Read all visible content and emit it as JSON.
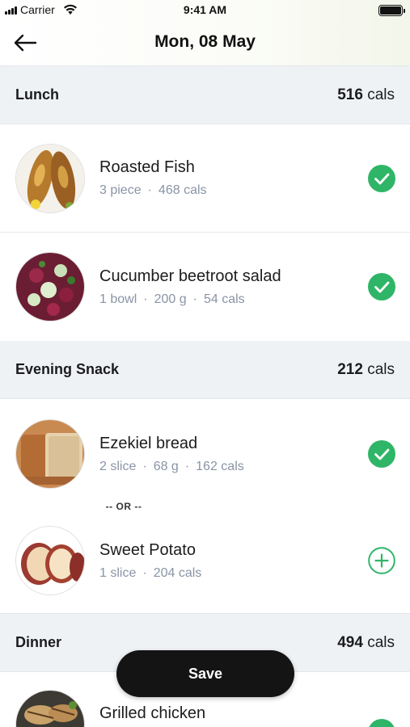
{
  "status_bar": {
    "carrier": "Carrier",
    "time": "9:41 AM"
  },
  "header": {
    "title": "Mon, 08 May"
  },
  "sections": [
    {
      "title": "Lunch",
      "cals_value": "516",
      "cals_unit": "cals",
      "items": [
        {
          "name": "Roasted Fish",
          "meta": [
            "3 piece",
            "468 cals"
          ],
          "status": "checked"
        },
        {
          "name": "Cucumber beetroot salad",
          "meta": [
            "1 bowl",
            "200 g",
            "54 cals"
          ],
          "status": "checked"
        }
      ]
    },
    {
      "title": "Evening Snack",
      "cals_value": "212",
      "cals_unit": "cals",
      "items": [
        {
          "name": "Ezekiel bread",
          "meta": [
            "2 slice",
            "68 g",
            "162 cals"
          ],
          "status": "checked"
        },
        {
          "name": "Sweet Potato",
          "meta": [
            "1 slice",
            "204 cals"
          ],
          "status": "add"
        }
      ],
      "separator": "-- OR --"
    },
    {
      "title": "Dinner",
      "cals_value": "494",
      "cals_unit": "cals",
      "items": [
        {
          "name": "Grilled chicken",
          "meta": [],
          "status": "checked"
        }
      ]
    }
  ],
  "save_label": "Save",
  "colors": {
    "accent": "#2fb567",
    "save_bg": "#141414",
    "section_bg": "#eff2f5",
    "meta_text": "#8a94a6"
  },
  "icons": {
    "back": "arrow-left-icon",
    "check": "check-circle-icon",
    "add": "plus-circle-icon"
  }
}
